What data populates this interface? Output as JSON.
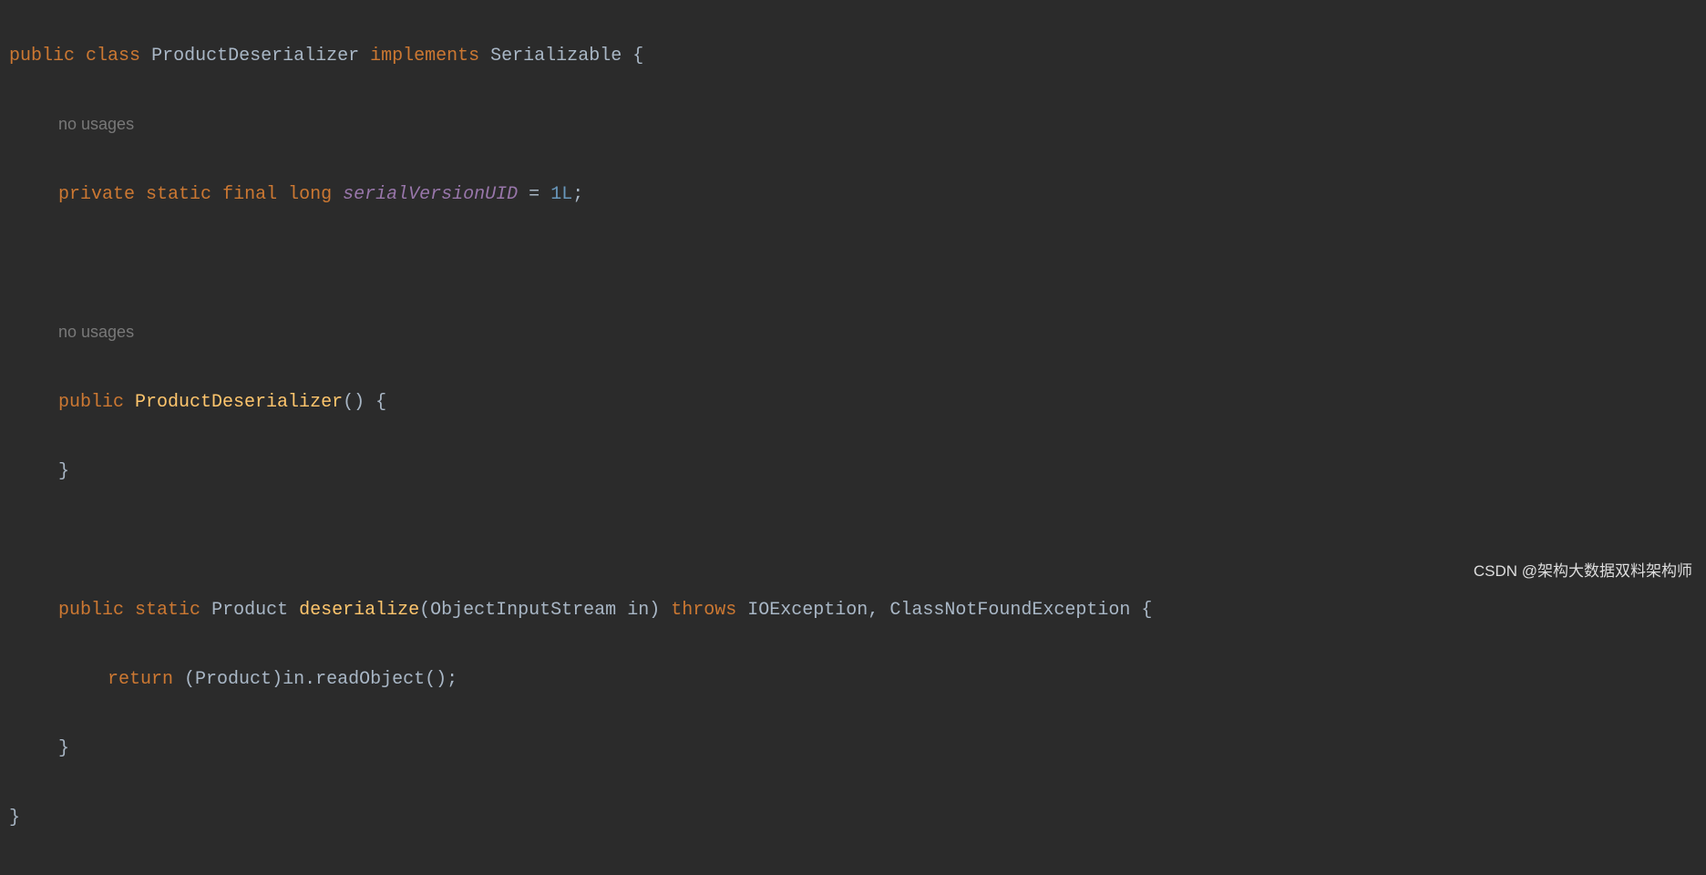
{
  "code": {
    "line1": {
      "kw_public": "public",
      "kw_class": "class",
      "class_name": "ProductDeserializer",
      "kw_implements": "implements",
      "interface_name": "Serializable",
      "brace": "{"
    },
    "hint1": "no usages",
    "line2": {
      "kw_private": "private",
      "kw_static": "static",
      "kw_final": "final",
      "kw_long": "long",
      "field_name": "serialVersionUID",
      "equals": "=",
      "value": "1L",
      "semi": ";"
    },
    "hint2": "no usages",
    "line3": {
      "kw_public": "public",
      "ctor_name": "ProductDeserializer",
      "parens": "()",
      "brace": "{"
    },
    "line4": {
      "brace_close": "}"
    },
    "line5": {
      "kw_public": "public",
      "kw_static": "static",
      "return_type": "Product",
      "method_name": "deserialize",
      "paren_open": "(",
      "param_type": "ObjectInputStream",
      "param_name": "in",
      "paren_close": ")",
      "kw_throws": "throws",
      "ex1": "IOException",
      "comma": ",",
      "ex2": "ClassNotFoundException",
      "brace": "{"
    },
    "line6": {
      "kw_return": "return",
      "cast_open": "(",
      "cast_type": "Product",
      "cast_close": ")",
      "obj": "in",
      "dot": ".",
      "call": "readObject",
      "parens": "()",
      "semi": ";"
    },
    "line7": {
      "brace_close": "}"
    },
    "line8": {
      "brace_close": "}"
    }
  },
  "watermark": "CSDN @架构大数据双料架构师"
}
